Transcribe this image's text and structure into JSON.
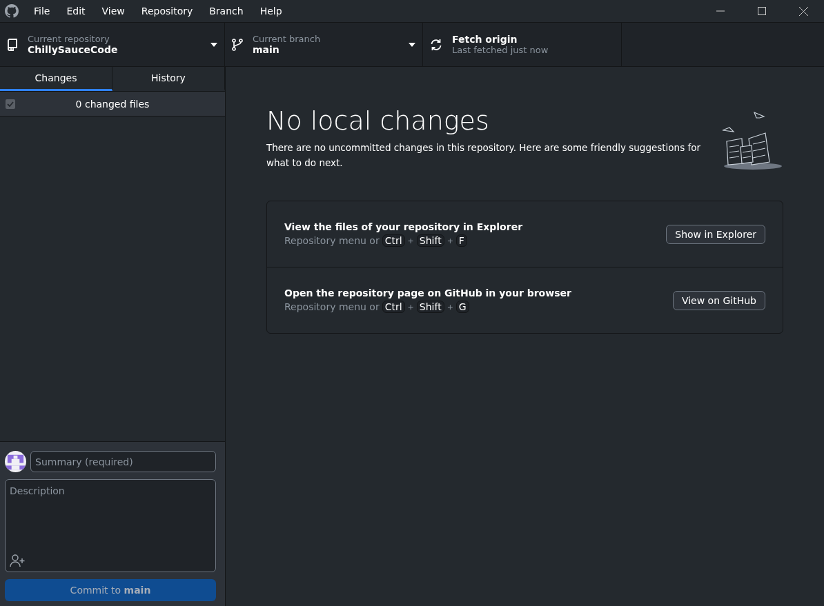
{
  "window": {
    "menu": [
      "File",
      "Edit",
      "View",
      "Repository",
      "Branch",
      "Help"
    ]
  },
  "toolbar": {
    "repository": {
      "label": "Current repository",
      "value": "ChillySauceCode"
    },
    "branch": {
      "label": "Current branch",
      "value": "main"
    },
    "fetch": {
      "label": "Fetch origin",
      "detail": "Last fetched just now"
    }
  },
  "tabs": [
    {
      "label": "Changes",
      "selected": true
    },
    {
      "label": "History",
      "selected": false
    }
  ],
  "changes": {
    "header": "0 changed files",
    "all_checked": true
  },
  "commit": {
    "summary": {
      "placeholder": "Summary (required)"
    },
    "description": {
      "placeholder": "Description"
    },
    "button": {
      "label": "Commit to **main**",
      "disabled": true
    }
  },
  "blankslate": {
    "title": "No local changes",
    "text": "There are no uncommitted changes in this repository. Here are some friendly suggestions for what to do next.",
    "suggestions": [
      {
        "title": "View the files of your repository in Explorer",
        "hint": "Repository menu or",
        "shortcut": [
          {
            "kind": "key",
            "text": "Ctrl"
          },
          {
            "kind": "plus",
            "text": "+"
          },
          {
            "kind": "key",
            "text": "Shift"
          },
          {
            "kind": "plus",
            "text": "+"
          },
          {
            "kind": "key",
            "text": "F"
          }
        ],
        "button": "Show in Explorer"
      },
      {
        "title": "Open the repository page on GitHub in your browser",
        "hint": "Repository menu or",
        "shortcut": [
          {
            "kind": "key",
            "text": "Ctrl"
          },
          {
            "kind": "plus",
            "text": "+"
          },
          {
            "kind": "key",
            "text": "Shift"
          },
          {
            "kind": "plus",
            "text": "+"
          },
          {
            "kind": "key",
            "text": "G"
          }
        ],
        "button": "View on GitHub"
      }
    ]
  }
}
